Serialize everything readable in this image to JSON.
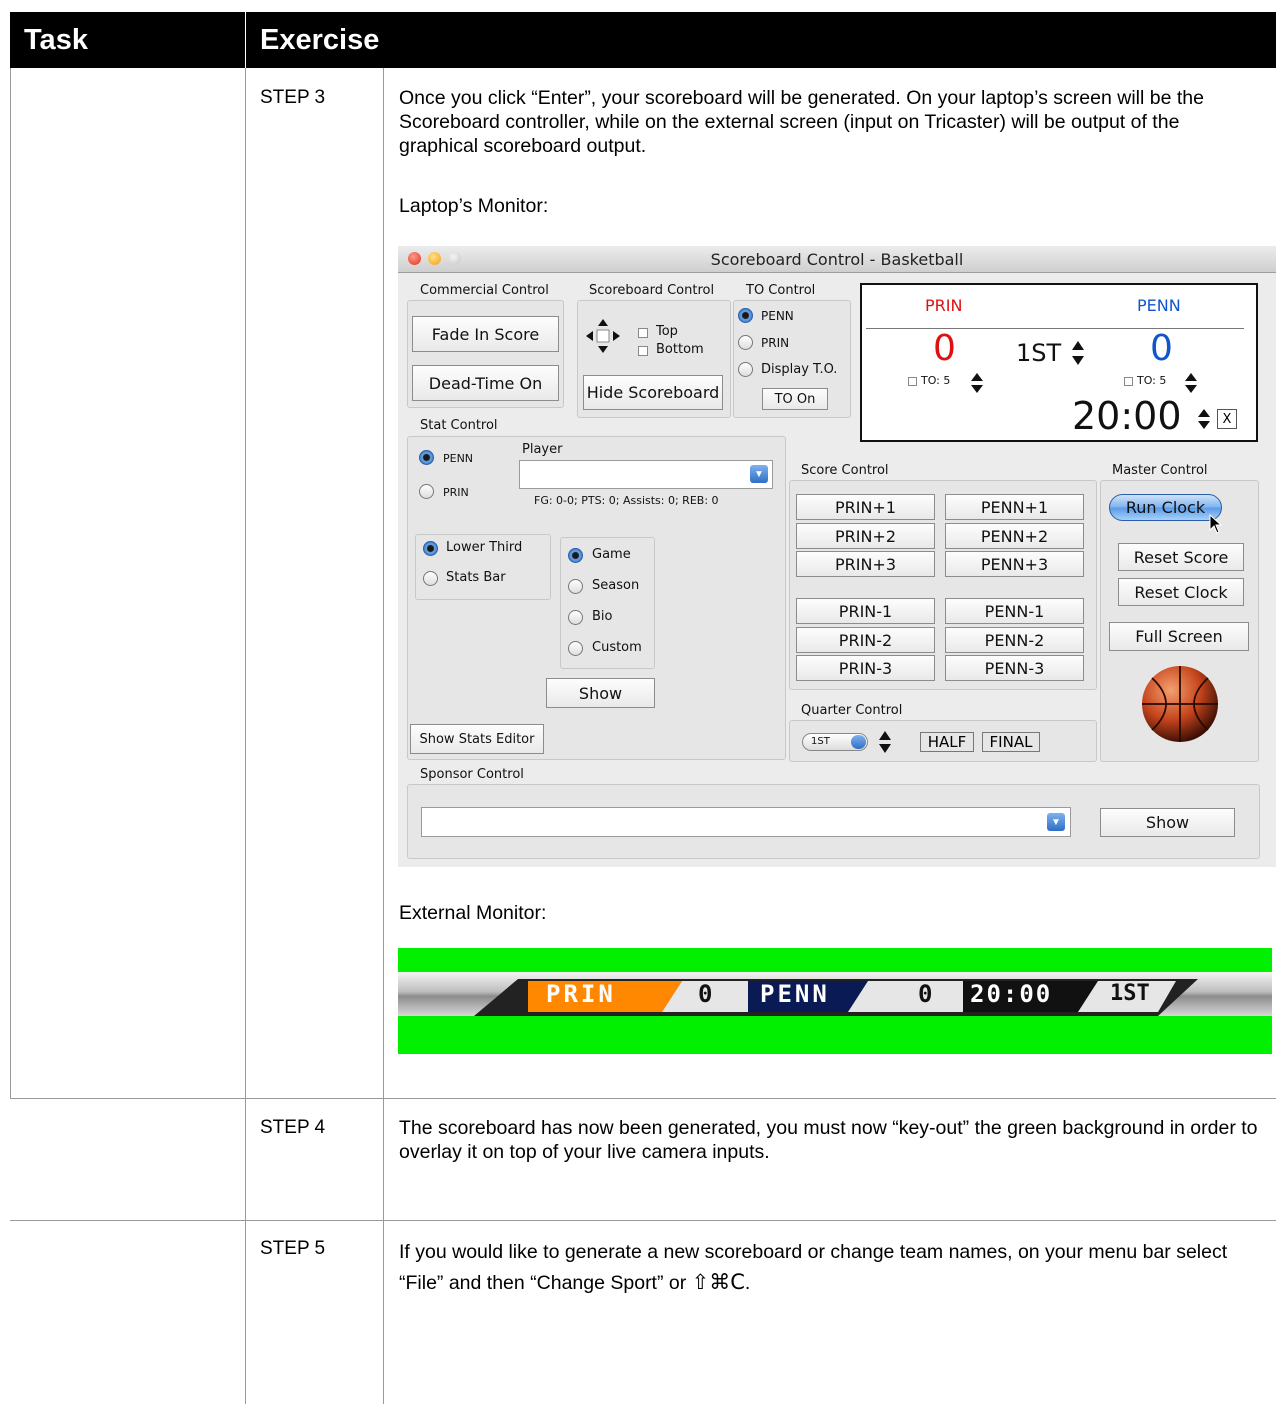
{
  "table": {
    "col1_header": "Task",
    "col2_header": "Exercise"
  },
  "step3": {
    "label": "STEP 3",
    "text": "Once you click “Enter”, your scoreboard will be generated.  On your laptop’s screen will be the Scoreboard controller, while on the external screen (input on Tricaster) will be output of the graphical scoreboard output.",
    "laptop_label": "Laptop’s Monitor:",
    "external_label": "External Monitor:"
  },
  "step4": {
    "label": "STEP 4",
    "text": "The scoreboard has now been generated, you must now “key-out” the green background in order to overlay it on top of your live camera inputs."
  },
  "step5": {
    "label": "STEP 5",
    "text_before": "If you would like to generate a new scoreboard or change team names, on your menu bar select “File” and then “Change Sport” or ",
    "shortcut": "⇧⌘C",
    "text_after": "."
  },
  "window": {
    "title": "Scoreboard Control - Basketball",
    "commercial": {
      "label": "Commercial Control",
      "fade_in": "Fade In Score",
      "dead_time": "Dead-Time On"
    },
    "scoreboard": {
      "label": "Scoreboard Control",
      "top": "Top",
      "bottom": "Bottom",
      "hide": "Hide Scoreboard"
    },
    "to_control": {
      "label": "TO Control",
      "opt1": "PENN",
      "opt2": "PRIN",
      "opt3": "Display T.O.",
      "button": "TO On"
    },
    "display": {
      "team1": "PRIN",
      "team2": "PENN",
      "score1": "0",
      "score2": "0",
      "period": "1ST",
      "to1": "TO: 5",
      "to2": "TO: 5",
      "clock": "20:00",
      "close": "X"
    },
    "stat": {
      "label": "Stat Control",
      "team1": "PENN",
      "team2": "PRIN",
      "player_label": "Player",
      "player_value": "",
      "summary": "FG: 0-0; PTS: 0; Assists: 0; REB: 0",
      "lower_third": "Lower Third",
      "stats_bar": "Stats Bar",
      "game": "Game",
      "season": "Season",
      "bio": "Bio",
      "custom": "Custom",
      "show": "Show",
      "editor": "Show Stats Editor"
    },
    "score_control": {
      "label": "Score Control",
      "left": [
        "PRIN+1",
        "PRIN+2",
        "PRIN+3",
        "PRIN-1",
        "PRIN-2",
        "PRIN-3"
      ],
      "right": [
        "PENN+1",
        "PENN+2",
        "PENN+3",
        "PENN-1",
        "PENN-2",
        "PENN-3"
      ]
    },
    "master": {
      "label": "Master Control",
      "run": "Run Clock",
      "reset_score": "Reset Score",
      "reset_clock": "Reset Clock",
      "full_screen": "Full Screen"
    },
    "quarter": {
      "label": "Quarter Control",
      "value": "1ST",
      "half": "HALF",
      "final": "FINAL"
    },
    "sponsor": {
      "label": "Sponsor Control",
      "value": "",
      "show": "Show"
    }
  },
  "ticker": {
    "team1": "PRIN",
    "score1": "0",
    "team2": "PENN",
    "score2": "0",
    "clock": "20:00",
    "period": "1ST"
  },
  "colors": {
    "green_screen": "#00f000",
    "team1_accent": "#ff8800",
    "header_bg": "#000000",
    "display_red": "#dd1111",
    "display_blue": "#1155cc"
  }
}
